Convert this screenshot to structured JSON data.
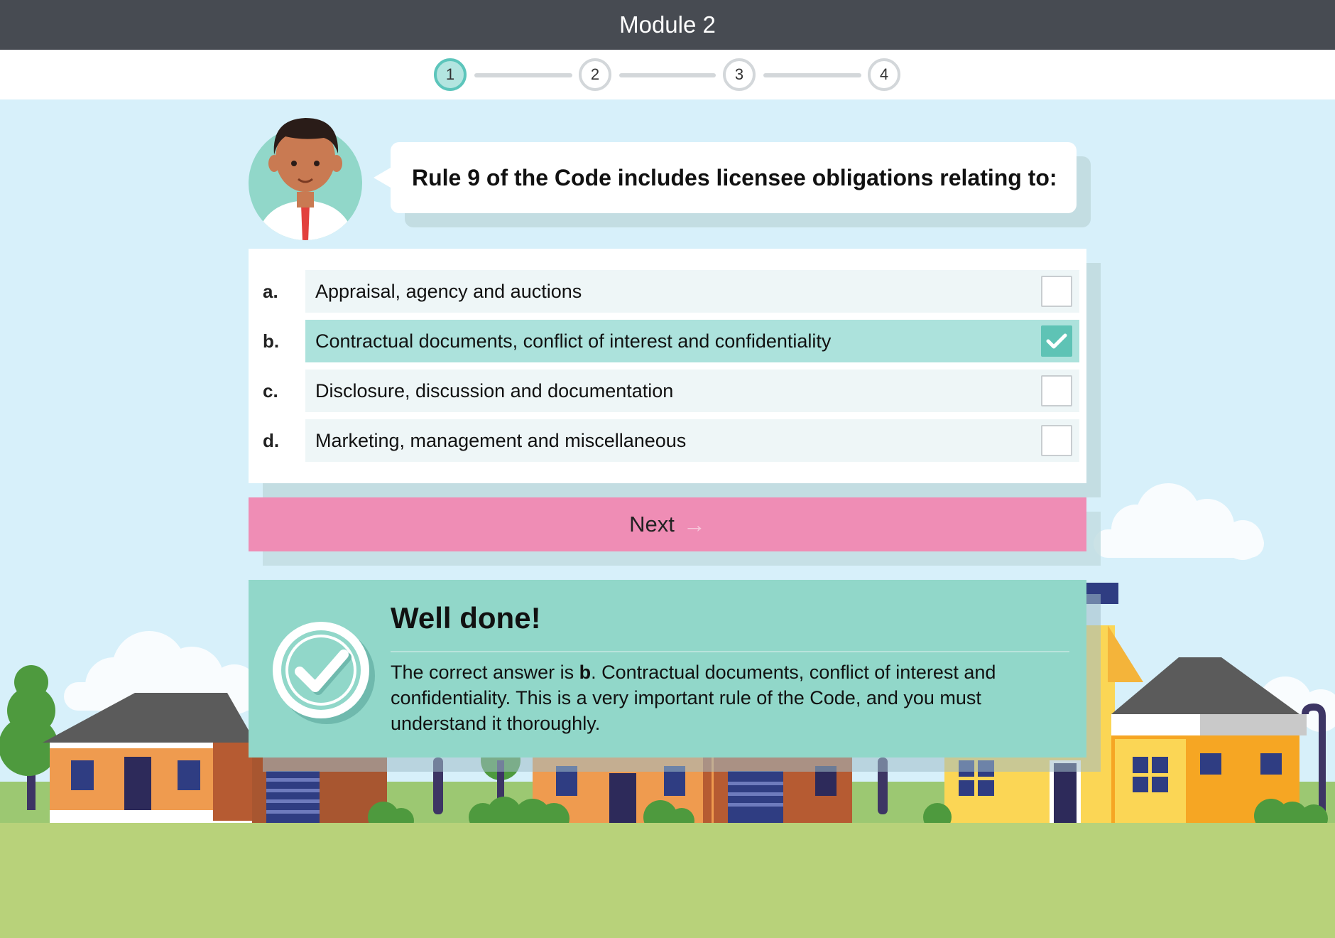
{
  "header": {
    "title": "Module 2"
  },
  "steps": [
    {
      "label": "1",
      "state": "active"
    },
    {
      "label": "2",
      "state": "upcoming"
    },
    {
      "label": "3",
      "state": "upcoming"
    },
    {
      "label": "4",
      "state": "upcoming"
    }
  ],
  "question": {
    "text": "Rule 9 of the Code includes licensee obligations relating to:"
  },
  "options": [
    {
      "letter": "a.",
      "text": "Appraisal, agency and auctions",
      "checked": false
    },
    {
      "letter": "b.",
      "text": "Contractual documents, conflict of interest and confidentiality",
      "checked": true
    },
    {
      "letter": "c.",
      "text": "Disclosure, discussion and documentation",
      "checked": false
    },
    {
      "letter": "d.",
      "text": "Marketing, management and miscellaneous",
      "checked": false
    }
  ],
  "next_button": {
    "label": "Next",
    "icon": "arrow-right-icon"
  },
  "feedback": {
    "title": "Well done!",
    "text_prefix": "The correct answer is ",
    "answer_letter": "b",
    "text_suffix": ". Contractual documents, conflict of interest and confidentiality. This is a very important rule of the Code, and you must understand it thoroughly.",
    "icon": "checkmark-circle-icon"
  },
  "colors": {
    "header_bg": "#474b52",
    "accent_teal": "#5cc5bb",
    "selected_row": "#ace2dc",
    "next_button": "#ef8db5",
    "feedback_bg": "#91d7c9",
    "sky": "#d7f0fa",
    "grass": "#b8d27a"
  }
}
